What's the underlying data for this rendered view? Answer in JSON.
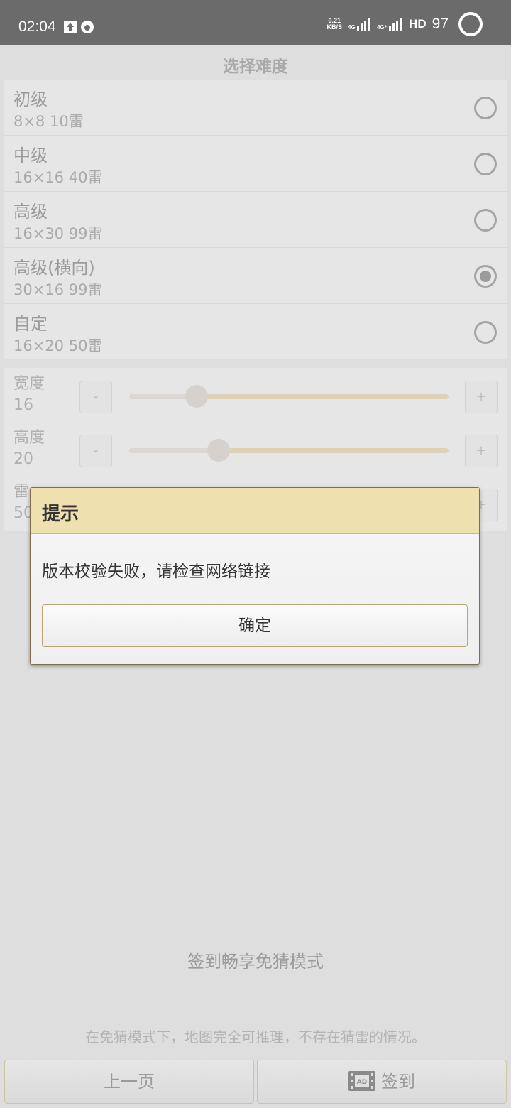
{
  "status_bar": {
    "time": "02:04",
    "net_speed_value": "0.21",
    "net_speed_unit": "KB/S",
    "sim1_label": "4G",
    "sim2_label": "4G⁺",
    "hd_label": "HD",
    "battery": "97"
  },
  "page": {
    "title": "选择难度"
  },
  "levels": [
    {
      "name": "初级",
      "desc": "8×8  10雷",
      "selected": false
    },
    {
      "name": "中级",
      "desc": "16×16  40雷",
      "selected": false
    },
    {
      "name": "高级",
      "desc": "16×30  99雷",
      "selected": false
    },
    {
      "name": "高级(横向)",
      "desc": "30×16  99雷",
      "selected": true
    },
    {
      "name": "自定",
      "desc": "16×20  50雷",
      "selected": false
    }
  ],
  "custom": {
    "width": {
      "label": "宽度",
      "value": "16",
      "level": 0.21
    },
    "height": {
      "label": "高度",
      "value": "20",
      "level": 0.28
    },
    "mines": {
      "label": "雷",
      "value": "50"
    },
    "minus_label": "-",
    "plus_label": "+"
  },
  "dialog": {
    "title": "提示",
    "message": "版本校验失败，请检查网络链接",
    "ok_label": "确定"
  },
  "promo": {
    "headline": "签到畅享免猜模式",
    "note": "在免猜模式下，地图完全可推理，不存在猜雷的情况。"
  },
  "bottom": {
    "prev_label": "上一页",
    "checkin_label": "签到",
    "ad_icon_text": "AD"
  },
  "colors": {
    "dialog_header": "#efe0b0",
    "accent_border": "#b9a577"
  }
}
